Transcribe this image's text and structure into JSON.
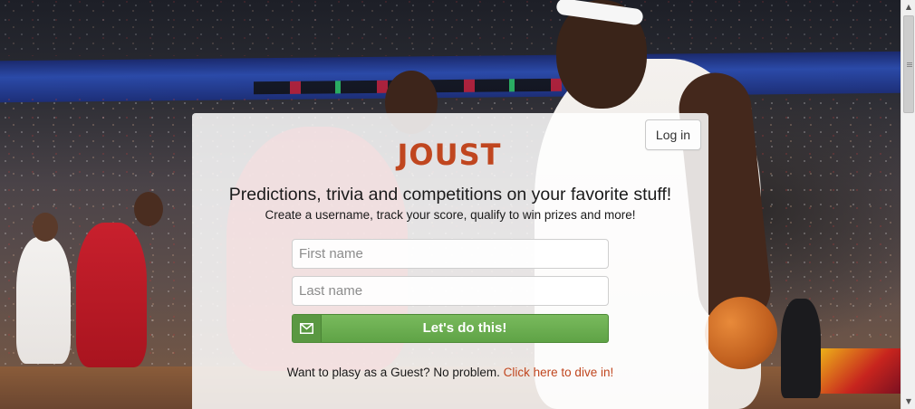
{
  "brand": {
    "logo_text": "JOUST",
    "accent_color": "#c0461f"
  },
  "header": {
    "login_label": "Log in"
  },
  "hero": {
    "headline": "Predictions, trivia and competitions on your favorite stuff!",
    "subline": "Create a username, track your score, qualify to win prizes and more!"
  },
  "form": {
    "first_name_placeholder": "First name",
    "first_name_value": "",
    "last_name_placeholder": "Last name",
    "last_name_value": "",
    "submit_label": "Let's do this!",
    "submit_icon": "envelope-icon",
    "submit_color": "#6aab4e"
  },
  "guest": {
    "prompt": "Want to plasy as a Guest? No problem.",
    "link_label": "Click here to dive in!"
  },
  "scrollbar": {
    "up_icon": "scroll-up-arrow-icon",
    "down_icon": "scroll-down-arrow-icon"
  }
}
